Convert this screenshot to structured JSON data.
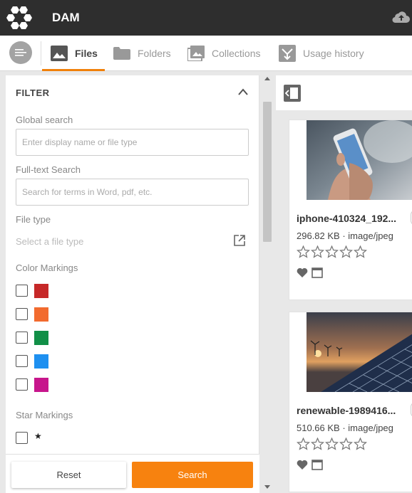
{
  "app": {
    "title": "DAM"
  },
  "tabs": [
    {
      "label": "Files",
      "icon": "image-icon",
      "active": true
    },
    {
      "label": "Folders",
      "icon": "folder-icon",
      "active": false
    },
    {
      "label": "Collections",
      "icon": "collections-icon",
      "active": false
    },
    {
      "label": "Usage history",
      "icon": "usage-history-icon",
      "active": false
    }
  ],
  "filter": {
    "title": "FILTER",
    "global_search": {
      "label": "Global search",
      "placeholder": "Enter display name or file type",
      "value": ""
    },
    "fulltext_search": {
      "label": "Full-text Search",
      "placeholder": "Search for terms in Word, pdf, etc.",
      "value": ""
    },
    "file_type": {
      "label": "File type",
      "placeholder": "Select a file type"
    },
    "color_markings": {
      "label": "Color Markings",
      "colors": [
        "#c62828",
        "#f26b2f",
        "#118f47",
        "#1e90f0",
        "#c7168c"
      ]
    },
    "star_markings": {
      "label": "Star Markings",
      "symbol": "★"
    },
    "reset_label": "Reset",
    "search_label": "Search"
  },
  "colors": {
    "accent": "#f7820f",
    "topbar": "#2e2e2e"
  },
  "assets": [
    {
      "name": "iphone-410324_192...",
      "size": "296.82 KB",
      "type": "image/jpeg",
      "rating": 0
    },
    {
      "name": "renewable-1989416...",
      "size": "510.66 KB",
      "type": "image/jpeg",
      "rating": 0
    }
  ]
}
